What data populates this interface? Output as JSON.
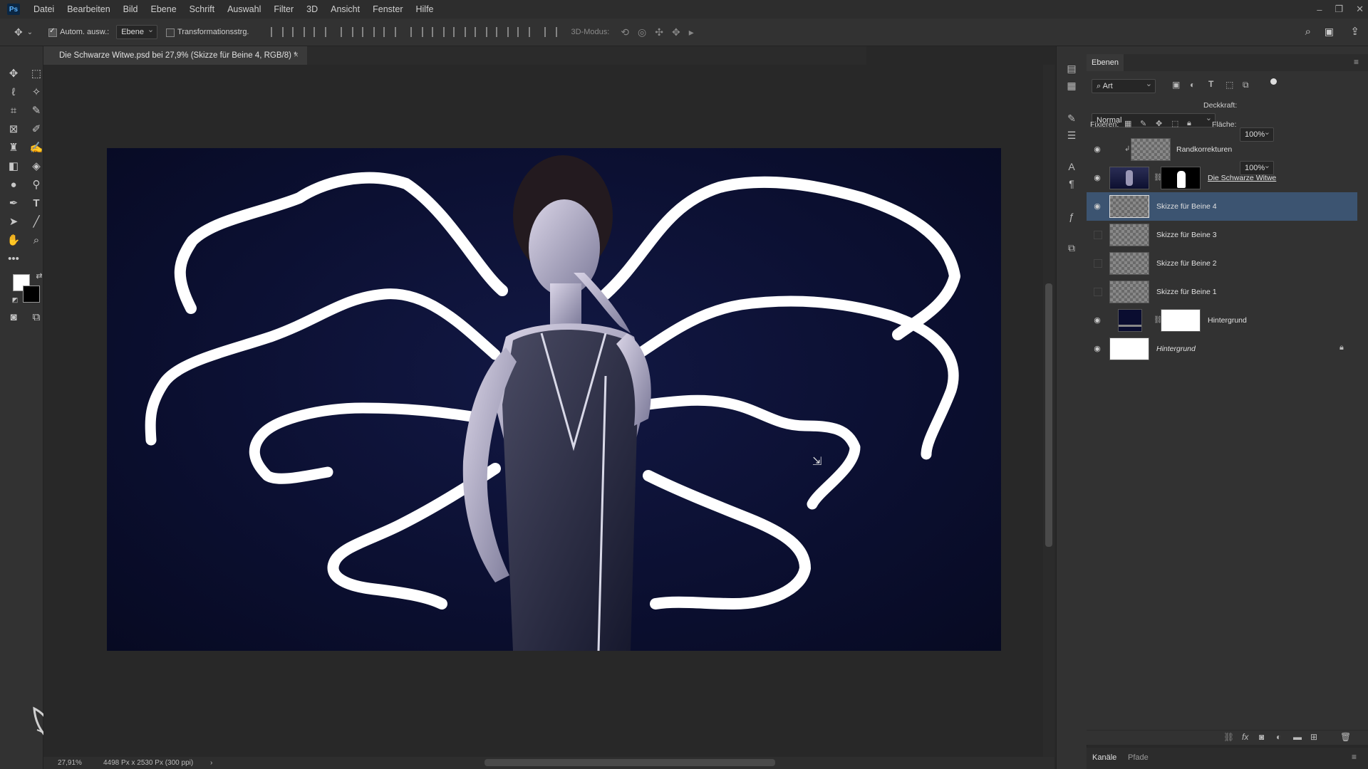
{
  "menubar": {
    "logo": "Ps",
    "items": [
      "Datei",
      "Bearbeiten",
      "Bild",
      "Ebene",
      "Schrift",
      "Auswahl",
      "Filter",
      "3D",
      "Ansicht",
      "Fenster",
      "Hilfe"
    ]
  },
  "options": {
    "auto_select_label": "Autom. ausw.:",
    "auto_select_value": "Ebene",
    "transform_label": "Transformationsstrg.",
    "mode_3d_label": "3D-Modus:"
  },
  "document": {
    "tab_title": "Die Schwarze Witwe.psd bei 27,9% (Skizze für Beine 4, RGB/8) *",
    "tab_close": "×"
  },
  "status": {
    "zoom": "27,91%",
    "dimensions": "4498 Px x 2530 Px (300 ppi)",
    "arrow": "›"
  },
  "layers": {
    "tab_label": "Ebenen",
    "filter_kind": "Art",
    "blend_mode": "Normal",
    "opacity_label": "Deckkraft:",
    "opacity_value": "100%",
    "lock_label": "Fixieren:",
    "fill_label": "Fläche:",
    "fill_value": "100%",
    "rows": [
      {
        "name": "Randkorrekturen",
        "visible": true
      },
      {
        "name": "Die Schwarze Witwe",
        "visible": true
      },
      {
        "name": "Skizze für Beine 4",
        "visible": true,
        "selected": true
      },
      {
        "name": "Skizze für Beine 3",
        "visible": false
      },
      {
        "name": "Skizze für Beine 2",
        "visible": false
      },
      {
        "name": "Skizze für Beine 1",
        "visible": false
      },
      {
        "name": "Hintergrund",
        "visible": true
      },
      {
        "name": "Hintergrund",
        "visible": true,
        "locked": true
      }
    ]
  },
  "bottom_tabs": [
    "Kanäle",
    "Pfade"
  ],
  "colors": {
    "accent_selected": "#3c5471",
    "canvas_bg": "#0b0f30",
    "app_bg": "#282828"
  }
}
